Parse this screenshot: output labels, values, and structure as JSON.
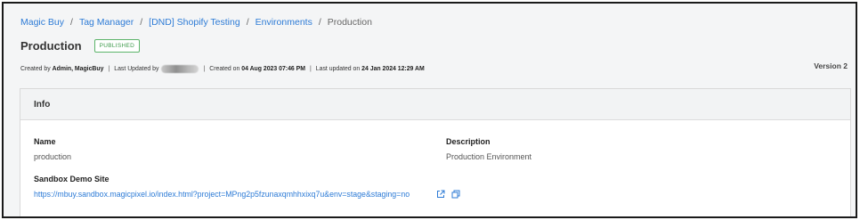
{
  "breadcrumb": {
    "items": [
      "Magic Buy",
      "Tag Manager",
      "[DND] Shopify Testing",
      "Environments"
    ],
    "current": "Production",
    "separator": "/"
  },
  "page": {
    "title": "Production",
    "status": "PUBLISHED",
    "version": "Version 2"
  },
  "meta": {
    "created_by_label": "Created by",
    "created_by": "Admin, MagicBuy",
    "last_updated_by_label": "Last Updated by",
    "created_on_label": "Created on",
    "created_on": "04 Aug 2023 07:46 PM",
    "last_updated_label": "Last updated on",
    "last_updated": "24 Jan 2024 12:29 AM"
  },
  "info": {
    "header": "Info",
    "name_label": "Name",
    "name_value": "production",
    "description_label": "Description",
    "description_value": "Production Environment",
    "sandbox_label": "Sandbox Demo Site",
    "sandbox_url": "https://mbuy.sandbox.magicpixel.io/index.html?project=MPng2p5fzunaxqmhhxixq7u&env=stage&staging=no"
  },
  "icons": {
    "open_link": "external-link-icon",
    "copy": "copy-icon"
  },
  "colors": {
    "link": "#2d7bd6",
    "published_badge": "#3c9a4a",
    "card_header_bg": "#f2f3f4",
    "page_bg": "#f4f5f6"
  }
}
